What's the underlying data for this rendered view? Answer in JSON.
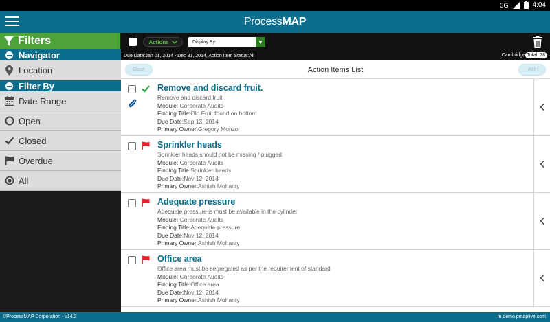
{
  "statusbar": {
    "signal": "3G",
    "time": "4:04"
  },
  "app": {
    "brand_light": "Process",
    "brand_bold": "MAP"
  },
  "sidebar": {
    "filters_label": "Filters",
    "navigator_label": "Navigator",
    "location_label": "Location",
    "filterby_label": "Filter By",
    "filters": [
      {
        "label": "Date Range",
        "icon": "calendar-icon"
      },
      {
        "label": "Open",
        "icon": "circle-icon"
      },
      {
        "label": "Closed",
        "icon": "checkmark-icon"
      },
      {
        "label": "Overdue",
        "icon": "flag-icon"
      },
      {
        "label": "All",
        "icon": "radio-dot-icon"
      }
    ]
  },
  "toolbar": {
    "actions_label": "Actions",
    "display_by_label": "Display By:"
  },
  "infobar": {
    "filter_summary": "Due Date:Jan 01, 2014 - Dec 31, 2014, Action Item Status:All",
    "location": "Cambridge",
    "total": "Total: 78"
  },
  "list": {
    "title": "Action Items List",
    "close_label": "Close",
    "add_label": "Add",
    "labels": {
      "module": "Module:",
      "finding": "Finding Title:",
      "due": "Due Date:",
      "owner": "Primary Owner:"
    },
    "items": [
      {
        "title": "Remove and discard fruit.",
        "description": "Remove and discard fruit.",
        "module": "Corporate Audits",
        "finding": "Old Fruit found on bottom",
        "due": "Sep 13, 2014",
        "owner": "Gregory Monzo",
        "status": "closed"
      },
      {
        "title": "Sprinkler heads",
        "description": "Sprinkler heads should not be missing / plugged",
        "module": "Corporate Audits",
        "finding": "Sprinkler heads",
        "due": "Nov 12, 2014",
        "owner": "Ashish Mohanty",
        "status": "overdue"
      },
      {
        "title": "Adequate pressure",
        "description": "Adequate pressure is must be available in the cylinder",
        "module": "Corporate Audits",
        "finding": "Adequate pressure",
        "due": "Nov 12, 2014",
        "owner": "Ashish Mohanty",
        "status": "overdue"
      },
      {
        "title": "Office area",
        "description": "Office area must be segregated as per the requirement of standard",
        "module": "Corporate Audits",
        "finding": "Office area",
        "due": "Nov 12, 2014",
        "owner": "Ashish Mohanty",
        "status": "overdue"
      }
    ]
  },
  "footer": {
    "copyright": "©ProcessMAP Corporation - v14.2",
    "domain": "m.demo.pmaplive.com"
  },
  "colors": {
    "primary": "#0c6e8c",
    "filters_green": "#4ea33a",
    "overdue_flag": "#e8202a",
    "closed_check": "#3aa84a"
  }
}
